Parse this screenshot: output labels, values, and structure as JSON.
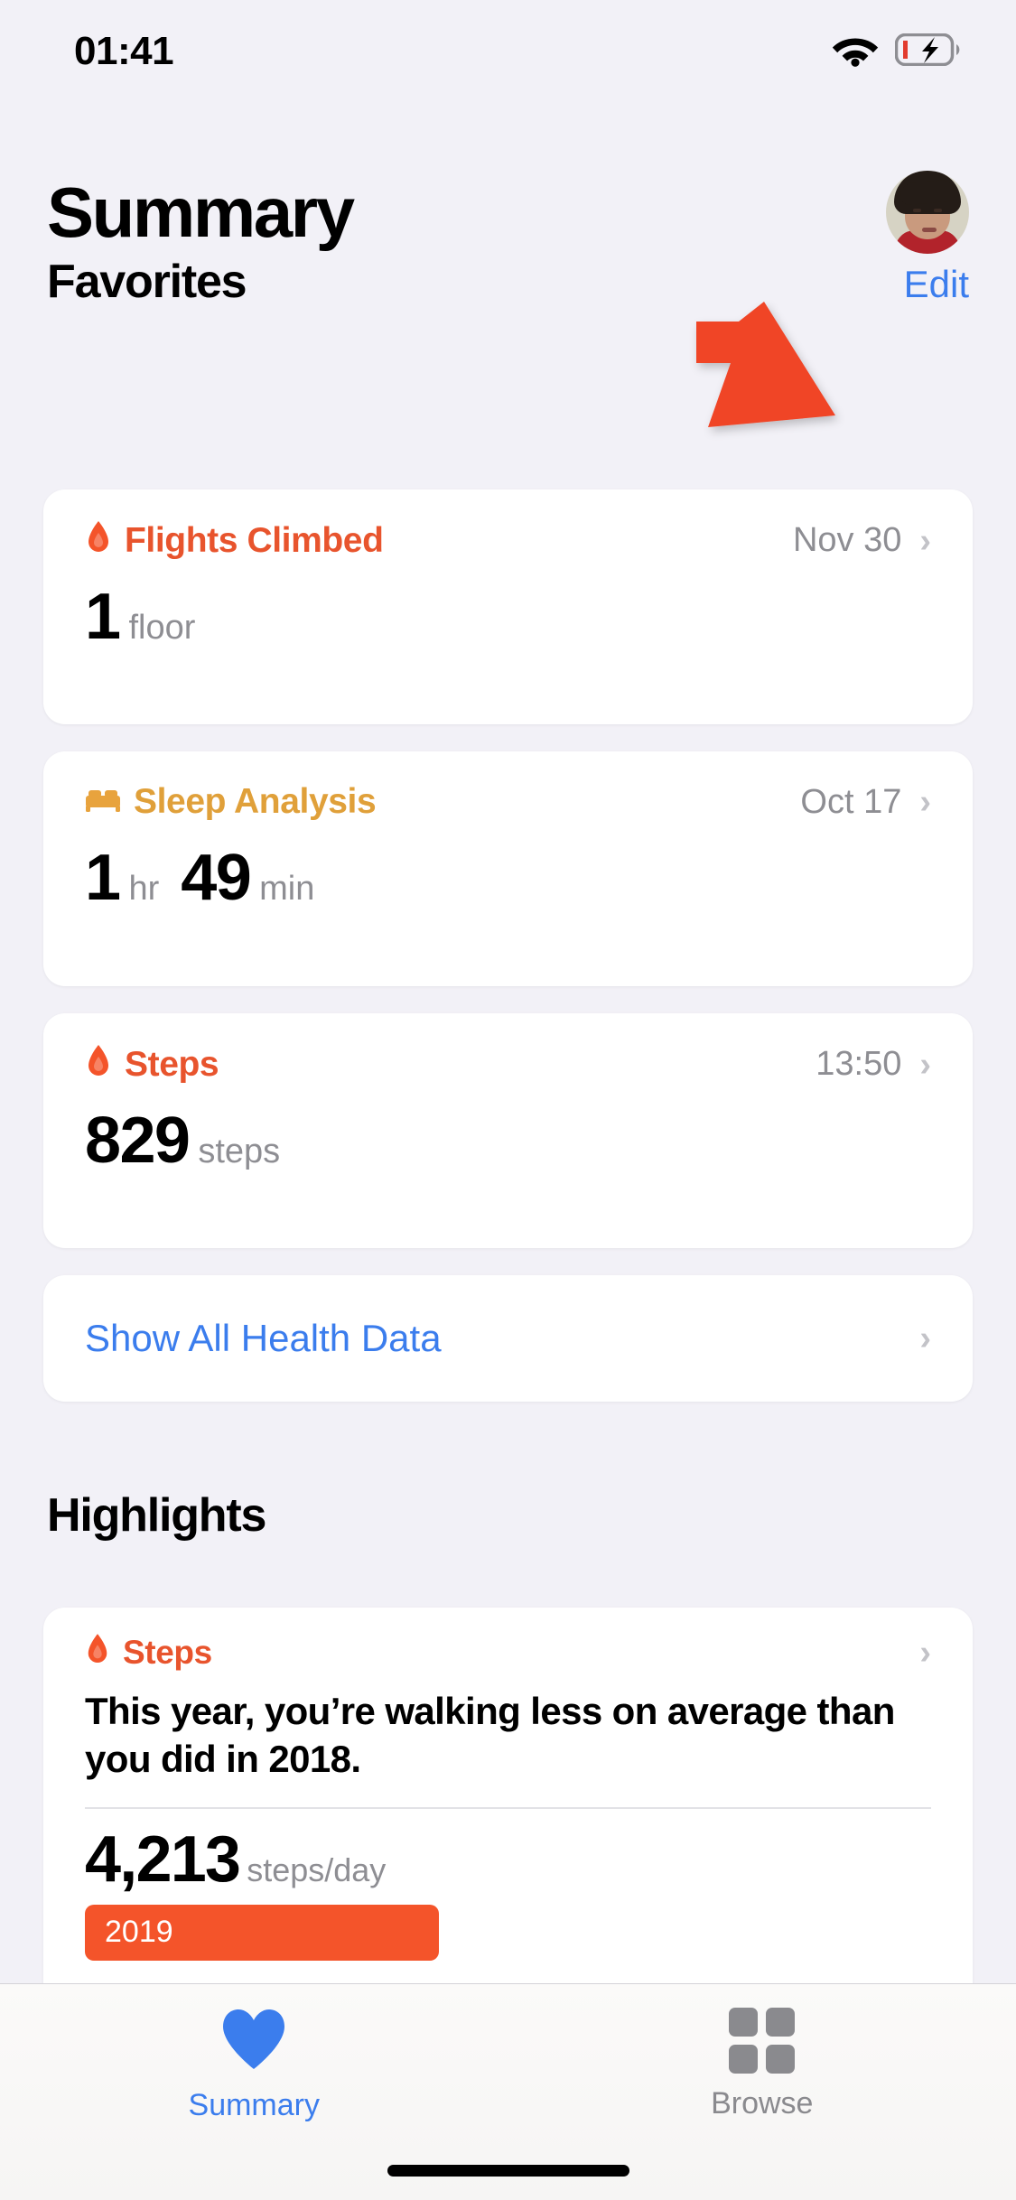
{
  "status_bar": {
    "time": "01:41",
    "wifi_icon": "wifi-icon",
    "battery_icon": "battery-charging-icon"
  },
  "header": {
    "title": "Summary",
    "avatar_icon": "profile-avatar"
  },
  "favorites": {
    "section_title": "Favorites",
    "edit_label": "Edit",
    "cards": [
      {
        "icon": "flame-icon",
        "icon_color": "#f4542a",
        "name": "Flights Climbed",
        "name_color": "#e8542d",
        "date": "Nov 30",
        "values": [
          {
            "number": "1",
            "unit": "floor"
          }
        ]
      },
      {
        "icon": "bed-icon",
        "icon_color": "#e8a33d",
        "name": "Sleep Analysis",
        "name_color": "#e0a03a",
        "date": "Oct 17",
        "values": [
          {
            "number": "1",
            "unit": "hr"
          },
          {
            "number": "49",
            "unit": "min"
          }
        ]
      },
      {
        "icon": "flame-icon",
        "icon_color": "#f4542a",
        "name": "Steps",
        "name_color": "#e8542d",
        "date": "13:50",
        "values": [
          {
            "number": "829",
            "unit": "steps"
          }
        ]
      }
    ],
    "show_all_label": "Show All Health Data"
  },
  "highlights": {
    "section_title": "Highlights",
    "card": {
      "icon": "flame-icon",
      "name": "Steps",
      "name_color": "#e8542d",
      "body_text": "This year, you’re walking less on average than you did in 2018.",
      "value_number": "4,213",
      "value_unit": "steps/day",
      "bar_label": "2019",
      "bar_color": "#f4542a"
    }
  },
  "annotation": {
    "arrow_icon": "red-arrow-pointing-to-edit",
    "arrow_color": "#f04427"
  },
  "tab_bar": {
    "tabs": [
      {
        "label": "Summary",
        "icon": "heart-icon",
        "active": true
      },
      {
        "label": "Browse",
        "icon": "grid-icon",
        "active": false
      }
    ]
  },
  "chart_data": {
    "type": "bar",
    "title": "Steps — yearly average comparison",
    "categories": [
      "2019"
    ],
    "values": [
      4213
    ],
    "ylabel": "steps/day",
    "xlabel": "",
    "annotations": [
      "This year, you’re walking less on average than you did in 2018."
    ],
    "grid": false,
    "legend": "none"
  }
}
